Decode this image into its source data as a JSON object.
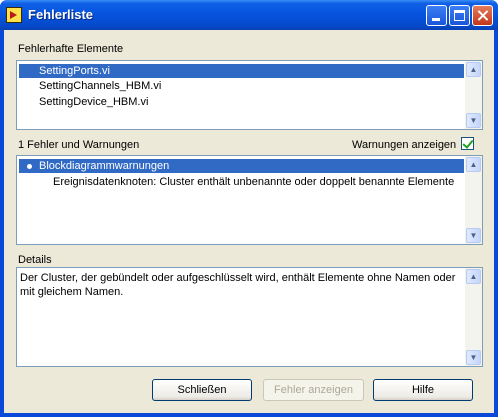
{
  "window": {
    "title": "Fehlerliste"
  },
  "elements_section": {
    "label": "Fehlerhafte Elemente",
    "items": [
      {
        "label": "SettingPorts.vi",
        "selected": true
      },
      {
        "label": "SettingChannels_HBM.vi",
        "selected": false
      },
      {
        "label": "SettingDevice_HBM.vi",
        "selected": false
      }
    ]
  },
  "warnings_section": {
    "count_label": "1 Fehler und Warnungen",
    "show_warnings_label": "Warnungen anzeigen",
    "show_warnings_checked": true,
    "items": [
      {
        "label": "Blockdiagrammwarnungen",
        "selected": true
      },
      {
        "label": "Ereignisdatenknoten: Cluster enthält unbenannte oder doppelt benannte Elemente",
        "selected": false
      }
    ]
  },
  "details_section": {
    "label": "Details",
    "text": "Der Cluster, der gebündelt oder aufgeschlüsselt wird, enthält Elemente ohne Namen oder mit gleichem Namen."
  },
  "buttons": {
    "close": "Schließen",
    "show_error": "Fehler anzeigen",
    "help": "Hilfe"
  },
  "colors": {
    "titlebar": "#0653de",
    "selection": "#316ac5",
    "dialog_bg": "#ece9d8"
  }
}
